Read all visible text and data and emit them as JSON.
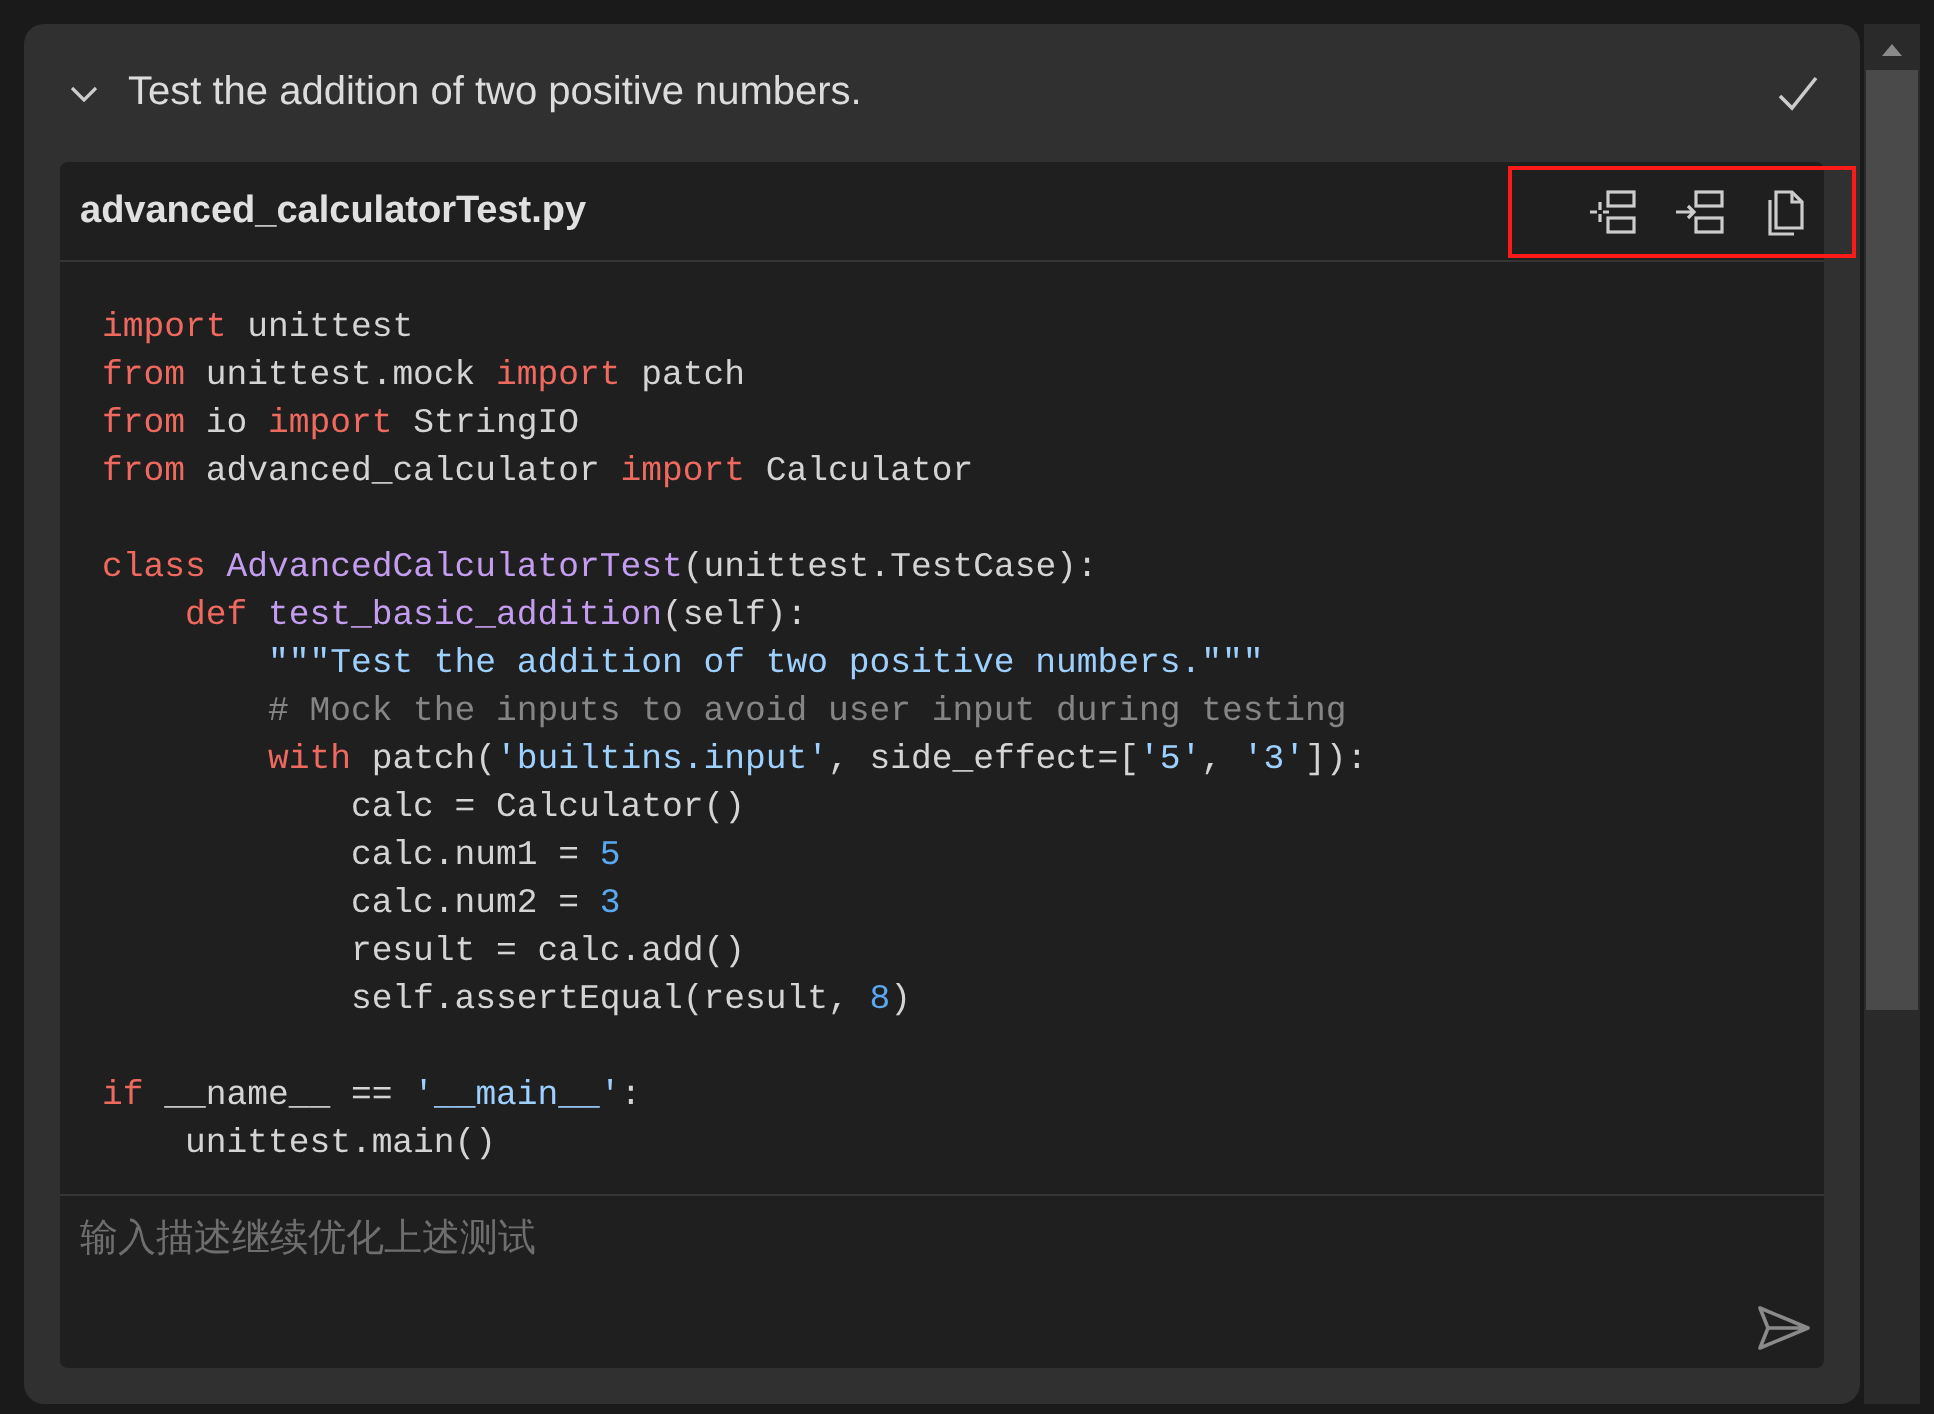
{
  "task": {
    "title": "Test the addition of two positive numbers.",
    "expanded": true,
    "done": true
  },
  "file": {
    "name": "advanced_calculatorTest.py",
    "toolbar_highlighted": true,
    "sections": [
      {
        "lines": [
          {
            "tokens": [
              {
                "t": "import",
                "kind": "keyword"
              },
              {
                "t": " unittest",
                "kind": "plain"
              }
            ]
          },
          {
            "tokens": [
              {
                "t": "from",
                "kind": "keyword"
              },
              {
                "t": " unittest.mock ",
                "kind": "plain"
              },
              {
                "t": "import",
                "kind": "keyword"
              },
              {
                "t": " patch",
                "kind": "plain"
              }
            ]
          },
          {
            "tokens": [
              {
                "t": "from",
                "kind": "keyword"
              },
              {
                "t": " io ",
                "kind": "plain"
              },
              {
                "t": "import",
                "kind": "keyword"
              },
              {
                "t": " StringIO",
                "kind": "plain"
              }
            ]
          },
          {
            "tokens": [
              {
                "t": "from",
                "kind": "keyword"
              },
              {
                "t": " advanced_calculator ",
                "kind": "plain"
              },
              {
                "t": "import",
                "kind": "keyword"
              },
              {
                "t": " Calculator",
                "kind": "plain"
              }
            ]
          }
        ]
      },
      {
        "lines": [
          {
            "tokens": [
              {
                "t": "class ",
                "kind": "keyword"
              },
              {
                "t": "AdvancedCalculatorTest",
                "kind": "name"
              },
              {
                "t": "(unittest.TestCase):",
                "kind": "plain"
              }
            ]
          },
          {
            "tokens": [
              {
                "t": "    def ",
                "kind": "keyword"
              },
              {
                "t": "test_basic_addition",
                "kind": "name"
              },
              {
                "t": "(self):",
                "kind": "plain"
              }
            ]
          },
          {
            "tokens": [
              {
                "t": "        \"\"\"Test the addition of two positive numbers.\"\"\"",
                "kind": "string"
              }
            ]
          },
          {
            "tokens": [
              {
                "t": "        # Mock the inputs to avoid user input during testing",
                "kind": "comment"
              }
            ]
          },
          {
            "tokens": [
              {
                "t": "        with",
                "kind": "keyword"
              },
              {
                "t": " patch(",
                "kind": "plain"
              },
              {
                "t": "'builtins.input'",
                "kind": "string"
              },
              {
                "t": ", side_effect=[",
                "kind": "plain"
              },
              {
                "t": "'5'",
                "kind": "string"
              },
              {
                "t": ", ",
                "kind": "plain"
              },
              {
                "t": "'3'",
                "kind": "string"
              },
              {
                "t": "]):",
                "kind": "plain"
              }
            ]
          },
          {
            "tokens": [
              {
                "t": "            calc = Calculator()",
                "kind": "plain"
              }
            ]
          },
          {
            "tokens": [
              {
                "t": "            calc.num1 = ",
                "kind": "plain"
              },
              {
                "t": "5",
                "kind": "number"
              }
            ]
          },
          {
            "tokens": [
              {
                "t": "            calc.num2 = ",
                "kind": "plain"
              },
              {
                "t": "3",
                "kind": "number"
              }
            ]
          },
          {
            "tokens": [
              {
                "t": "            result = calc.add()",
                "kind": "plain"
              }
            ]
          },
          {
            "tokens": [
              {
                "t": "            self.assertEqual(result, ",
                "kind": "plain"
              },
              {
                "t": "8",
                "kind": "number"
              },
              {
                "t": ")",
                "kind": "plain"
              }
            ]
          }
        ]
      },
      {
        "lines": [
          {
            "tokens": [
              {
                "t": "if",
                "kind": "keyword"
              },
              {
                "t": " __name__ == ",
                "kind": "plain"
              },
              {
                "t": "'__main__'",
                "kind": "string"
              },
              {
                "t": ":",
                "kind": "plain"
              }
            ]
          },
          {
            "tokens": [
              {
                "t": "    unittest.main()",
                "kind": "plain"
              }
            ]
          }
        ]
      }
    ]
  },
  "prompt": {
    "placeholder": "输入描述继续优化上述测试"
  }
}
